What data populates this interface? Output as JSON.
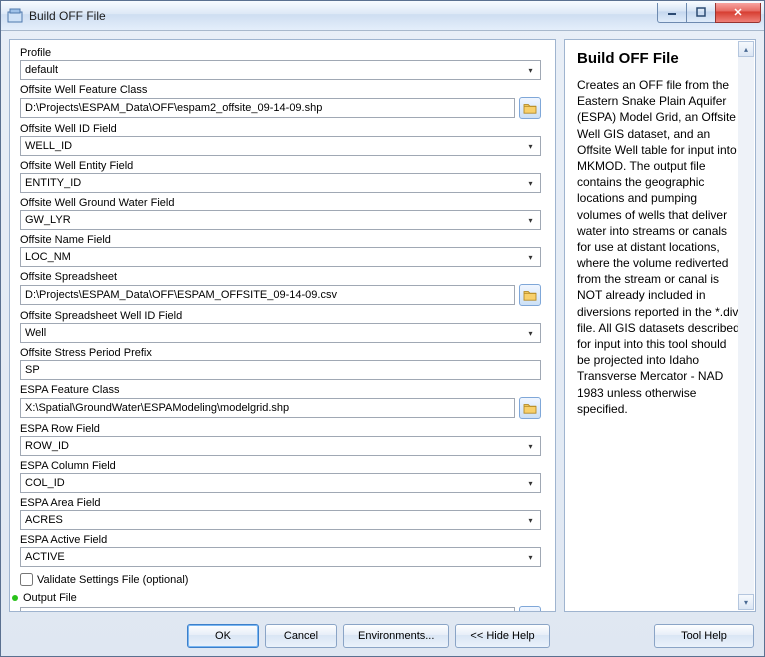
{
  "window": {
    "title": "Build OFF File"
  },
  "fields": {
    "profile": {
      "label": "Profile",
      "value": "default"
    },
    "offsite_fc": {
      "label": "Offsite Well Feature Class",
      "value": "D:\\Projects\\ESPAM_Data\\OFF\\espam2_offsite_09-14-09.shp"
    },
    "offsite_id": {
      "label": "Offsite Well ID Field",
      "value": "WELL_ID"
    },
    "offsite_entity": {
      "label": "Offsite Well Entity Field",
      "value": "ENTITY_ID"
    },
    "offsite_gw": {
      "label": "Offsite Well Ground Water Field",
      "value": "GW_LYR"
    },
    "offsite_name": {
      "label": "Offsite Name Field",
      "value": "LOC_NM"
    },
    "offsite_sheet": {
      "label": "Offsite Spreadsheet",
      "value": "D:\\Projects\\ESPAM_Data\\OFF\\ESPAM_OFFSITE_09-14-09.csv"
    },
    "offsite_sheet_id": {
      "label": "Offsite Spreadsheet Well ID Field",
      "value": "Well"
    },
    "stress_prefix": {
      "label": "Offsite Stress Period Prefix",
      "value": "SP"
    },
    "espa_fc": {
      "label": "ESPA Feature Class",
      "value": "X:\\Spatial\\GroundWater\\ESPAModeling\\modelgrid.shp"
    },
    "espa_row": {
      "label": "ESPA Row Field",
      "value": "ROW_ID"
    },
    "espa_col": {
      "label": "ESPA Column Field",
      "value": "COL_ID"
    },
    "espa_area": {
      "label": "ESPA Area Field",
      "value": "ACRES"
    },
    "espa_active": {
      "label": "ESPA Active Field",
      "value": "ACTIVE"
    },
    "validate": {
      "label": "Validate Settings File (optional)"
    },
    "output": {
      "label": "Output File",
      "value": ""
    }
  },
  "buttons": {
    "ok": "OK",
    "cancel": "Cancel",
    "env": "Environments...",
    "hide_help": "<< Hide Help",
    "tool_help": "Tool Help"
  },
  "help": {
    "title": "Build OFF File",
    "body": "Creates an OFF file from the Eastern Snake Plain Aquifer (ESPA) Model Grid, an Offsite Well GIS dataset, and an Offsite Well table for input into MKMOD. The output file contains the geographic locations and pumping volumes of wells that deliver water into streams or canals for use at distant locations, where the volume rediverted from the stream or canal is NOT already included in diversions reported in the *.div file. All GIS datasets described for input into this tool should be projected into Idaho Transverse Mercator - NAD 1983 unless otherwise specified."
  }
}
